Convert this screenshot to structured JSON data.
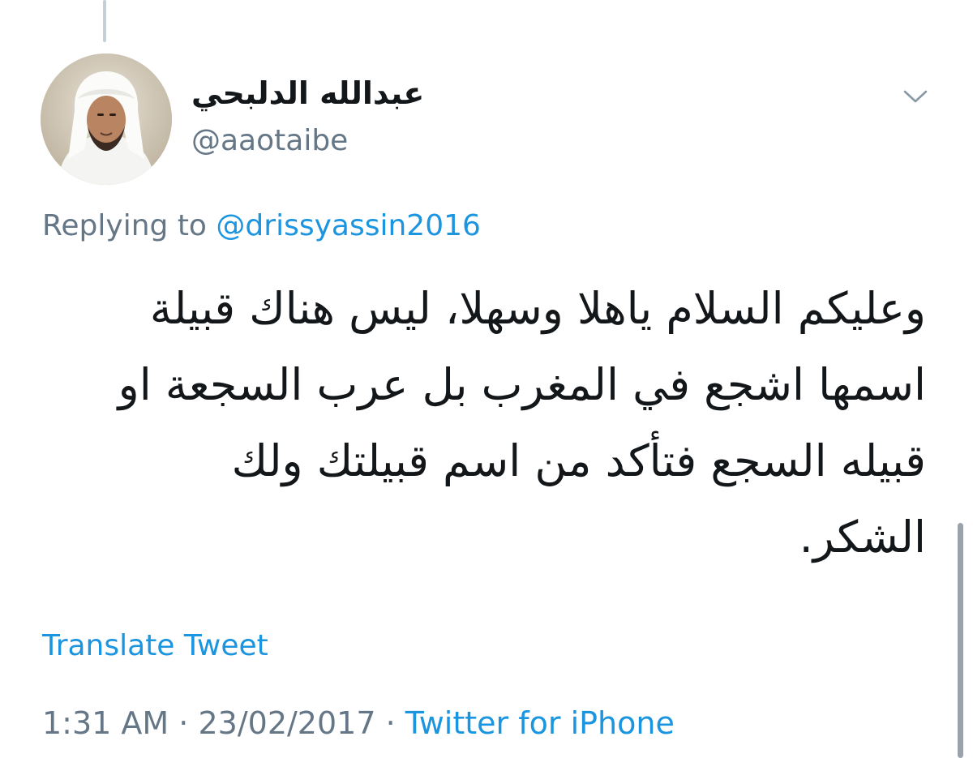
{
  "tweet": {
    "author": {
      "display_name": "عبدالله الدلبحي",
      "handle": "@aaotaibe"
    },
    "replying_prefix": "Replying to",
    "replying_to": "@drissyassin2016",
    "text_lines": [
      "وعليكم السلام ياهلا وسهلا، ليس هناك قبيلة",
      "اسمها اشجع في المغرب بل عرب السجعة او",
      "قبيله السجع فتأكد من اسم قبيلتك ولك",
      "الشكر."
    ],
    "translate_label": "Translate Tweet",
    "time": "1:31 AM",
    "separator": "·",
    "date": "23/02/2017",
    "source": "Twitter for iPhone"
  },
  "icons": {
    "menu": "chevron-down-icon"
  },
  "colors": {
    "link": "#1b95e0",
    "secondary_text": "#657786",
    "primary_text": "#14171a",
    "thread_line": "#c4cfd6"
  }
}
